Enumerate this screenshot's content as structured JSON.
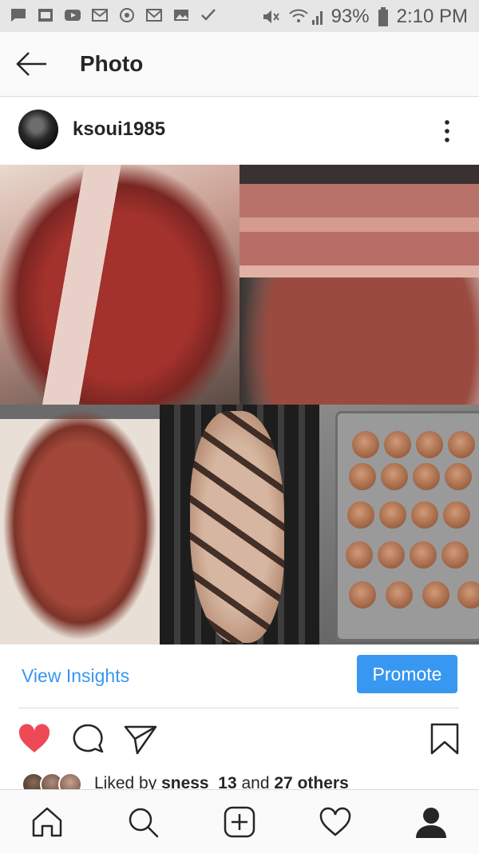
{
  "status_bar": {
    "battery": "93%",
    "time": "2:10 PM"
  },
  "header": {
    "title": "Photo"
  },
  "post": {
    "username": "ksoui1985",
    "view_insights": "View Insights",
    "promote": "Promote",
    "likes_prefix": "Liked by ",
    "liked_by_user": "sness_13",
    "likes_and": " and ",
    "likes_others": "27 others"
  },
  "colors": {
    "accent": "#3897f0",
    "like_heart": "#ed4956"
  },
  "icons": {
    "back": "back-arrow-icon",
    "more": "more-vertical-icon",
    "like": "heart-filled-icon",
    "comment": "comment-icon",
    "share": "paper-plane-icon",
    "save": "bookmark-icon",
    "home": "home-icon",
    "search": "search-icon",
    "add": "add-post-icon",
    "activity": "heart-outline-icon",
    "profile": "profile-icon"
  }
}
